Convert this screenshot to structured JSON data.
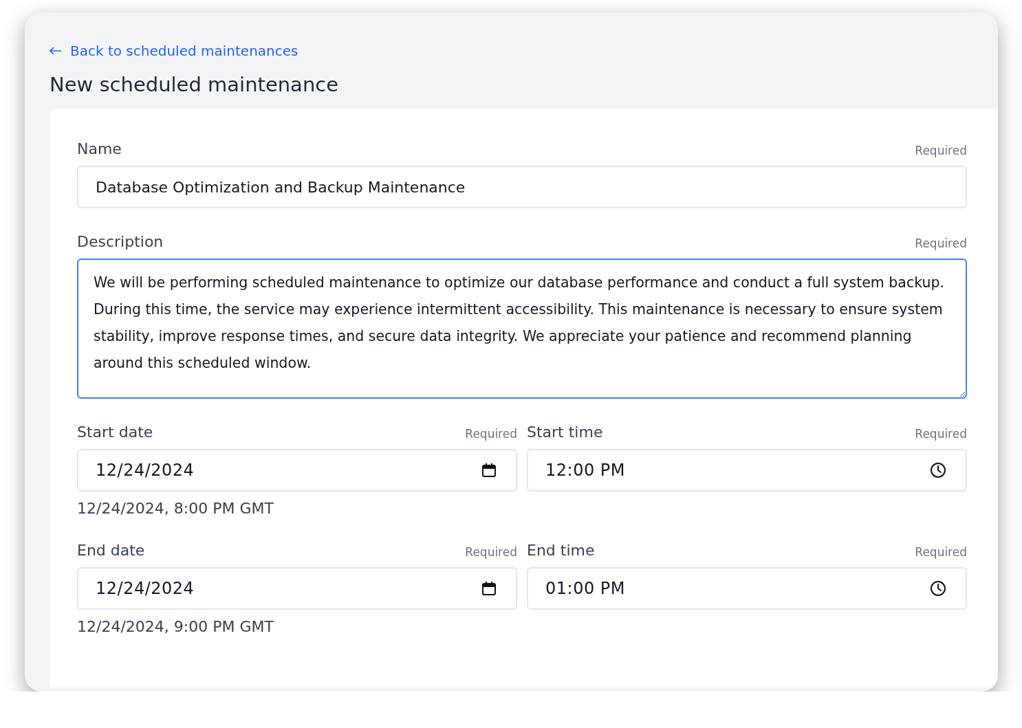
{
  "back_link": {
    "label": "Back to scheduled maintenances"
  },
  "title": "New scheduled maintenance",
  "fields": [
    {
      "kind": "text",
      "label": "Name",
      "required": "Required",
      "value": "Database Optimization and Backup Maintenance",
      "focused": false
    },
    {
      "kind": "textarea",
      "label": "Description",
      "required": "Required",
      "value": "We will be performing scheduled maintenance to optimize our database performance and conduct a full system backup. During this time, the service may experience intermittent accessibility. This maintenance is necessary to ensure system stability, improve response times, and secure data integrity. We appreciate your patience and recommend planning around this scheduled window.",
      "focused": true
    },
    {
      "kind": "date",
      "label": "Start date",
      "required": "Required",
      "value": "12/24/2024",
      "hint": "12/24/2024, 8:00 PM GMT",
      "focused": false
    },
    {
      "kind": "time",
      "label": "Start time",
      "required": "Required",
      "value": "12:00 PM",
      "focused": false
    },
    {
      "kind": "date",
      "label": "End date",
      "required": "Required",
      "value": "12/24/2024",
      "hint": "12/24/2024, 9:00 PM GMT",
      "focused": false
    },
    {
      "kind": "time",
      "label": "End time",
      "required": "Required",
      "value": "01:00 PM",
      "focused": false
    }
  ]
}
